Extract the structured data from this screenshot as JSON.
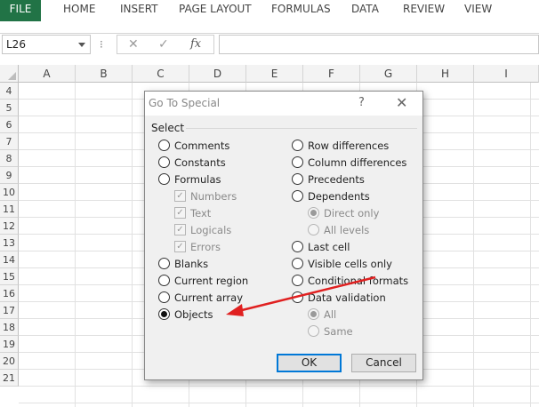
{
  "ribbon": {
    "tabs": [
      "FILE",
      "HOME",
      "INSERT",
      "PAGE LAYOUT",
      "FORMULAS",
      "DATA",
      "REVIEW",
      "VIEW"
    ]
  },
  "formula_bar": {
    "name_box": "L26",
    "cancel_icon": "✕",
    "enter_icon": "✓",
    "fx_label": "fx",
    "formula_value": ""
  },
  "grid": {
    "columns": [
      "A",
      "B",
      "C",
      "D",
      "E",
      "F",
      "G",
      "H",
      "I"
    ],
    "rows": [
      "4",
      "5",
      "6",
      "7",
      "8",
      "9",
      "10",
      "11",
      "12",
      "13",
      "14",
      "15",
      "16",
      "17",
      "18",
      "19",
      "20",
      "21"
    ]
  },
  "dialog": {
    "title": "Go To Special",
    "help": "?",
    "close": "✕",
    "section": "Select",
    "left_options": [
      {
        "label": "Comments"
      },
      {
        "label": "Constants"
      },
      {
        "label": "Formulas"
      },
      {
        "label": "Numbers"
      },
      {
        "label": "Text"
      },
      {
        "label": "Logicals"
      },
      {
        "label": "Errors"
      },
      {
        "label": "Blanks"
      },
      {
        "label": "Current region"
      },
      {
        "label": "Current array"
      },
      {
        "label": "Objects"
      }
    ],
    "right_options": [
      {
        "label": "Row differences"
      },
      {
        "label": "Column differences"
      },
      {
        "label": "Precedents"
      },
      {
        "label": "Dependents"
      },
      {
        "label": "Direct only"
      },
      {
        "label": "All levels"
      },
      {
        "label": "Last cell"
      },
      {
        "label": "Visible cells only"
      },
      {
        "label": "Conditional formats"
      },
      {
        "label": "Data validation"
      },
      {
        "label": "All"
      },
      {
        "label": "Same"
      }
    ],
    "selected_option": "Objects",
    "ok_label": "OK",
    "cancel_label": "Cancel"
  },
  "colors": {
    "file_tab": "#217346",
    "arrow": "#e02020",
    "ok_border": "#0078d7"
  }
}
